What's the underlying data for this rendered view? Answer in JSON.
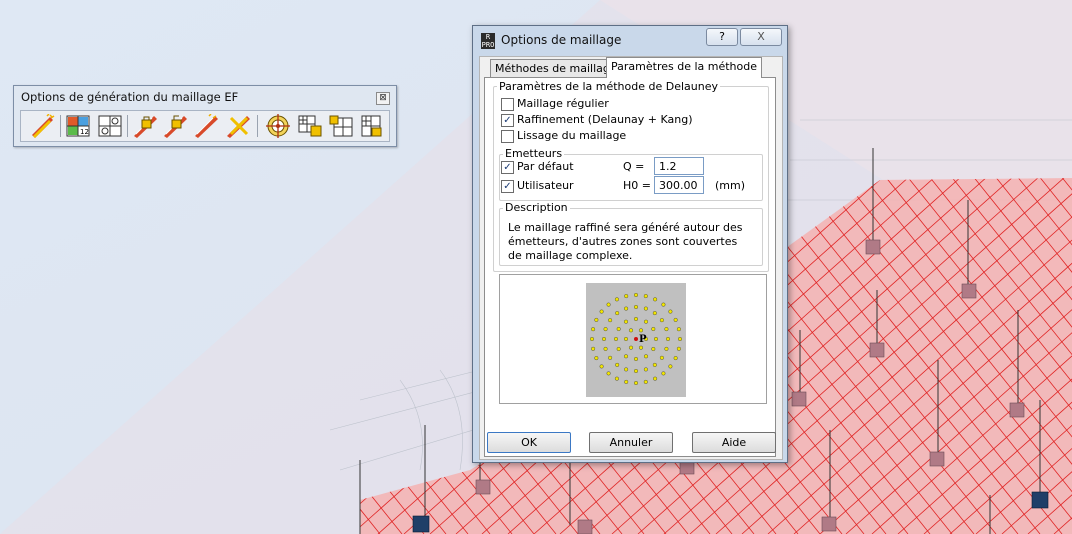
{
  "toolbar": {
    "title": "Options de génération du maillage EF",
    "close_glyph": "⊠",
    "buttons": [
      {
        "icon": "mesh-wand-icon"
      },
      {
        "icon": "mesh-grid-numbered-icon"
      },
      {
        "icon": "mesh-nodes-icon"
      },
      {
        "icon": "mesh-lock-icon"
      },
      {
        "icon": "mesh-lock-open-icon"
      },
      {
        "icon": "mesh-wand-2-icon"
      },
      {
        "icon": "mesh-delete-icon"
      },
      {
        "icon": "mesh-target-icon"
      },
      {
        "icon": "mesh-refine-icon"
      },
      {
        "icon": "mesh-refine-2-icon"
      },
      {
        "icon": "mesh-refine-3-icon"
      }
    ]
  },
  "dialog": {
    "app_icon_text": "R PRO",
    "title": "Options de maillage",
    "help_glyph": "?",
    "close_glyph": "X",
    "tabs": [
      {
        "label": "Méthodes de maillage",
        "active": false
      },
      {
        "label": "Paramètres de la méthode",
        "active": true
      }
    ],
    "delauney_group": {
      "title": "Paramètres de la méthode de Delauney",
      "options": [
        {
          "label": "Maillage régulier",
          "checked": false
        },
        {
          "label": "Raffinement (Delaunay + Kang)",
          "checked": true
        },
        {
          "label": "Lissage du maillage",
          "checked": false
        }
      ]
    },
    "emitters_group": {
      "title": "Emetteurs",
      "default": {
        "label": "Par défaut",
        "checked": true,
        "param_label": "Q =",
        "value": "1.2"
      },
      "user": {
        "label": "Utilisateur",
        "checked": true,
        "param_label": "H0 =",
        "value": "300.00",
        "unit": "(mm)"
      }
    },
    "description": {
      "title": "Description",
      "text": "Le maillage raffiné sera généré autour des émetteurs, d'autres zones sont couvertes de maillage complexe."
    },
    "preview": {
      "point_label": "P"
    },
    "buttons": {
      "ok": "OK",
      "cancel": "Annuler",
      "help": "Aide"
    }
  },
  "colors": {
    "mesh_fill": "#f4a7a7",
    "mesh_line": "#e02020",
    "dialog_title_bg": "#c9d8ea",
    "preview_bg": "#c0c0c0",
    "preview_dot": "#f2e600"
  }
}
